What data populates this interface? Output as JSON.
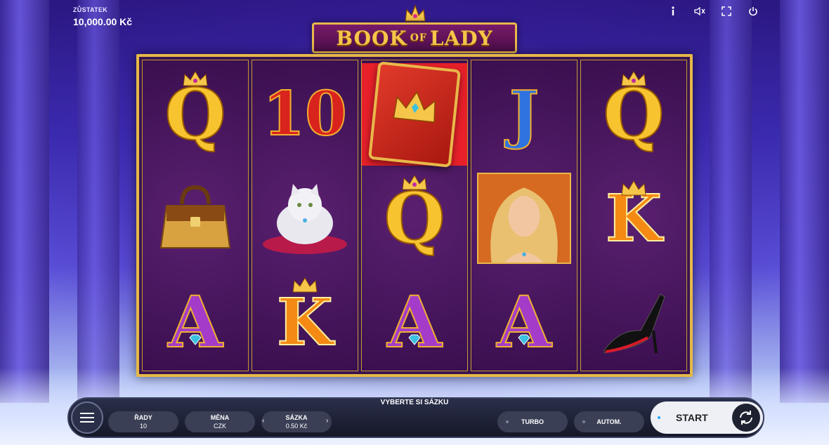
{
  "header": {
    "balance_label": "ZŮSTATEK",
    "balance_value": "10,000.00 Kč",
    "icons": [
      "info-icon",
      "volume-icon",
      "fullscreen-icon",
      "power-icon"
    ]
  },
  "logo": {
    "word1": "BOOK",
    "word2": "OF",
    "word3": "LADY"
  },
  "reels": [
    [
      "Q",
      "handbag",
      "A"
    ],
    [
      "10",
      "cat",
      "K"
    ],
    [
      "book",
      "Q",
      "A"
    ],
    [
      "J",
      "lady",
      "A"
    ],
    [
      "Q",
      "K",
      "shoe"
    ]
  ],
  "panel": {
    "title": "VYBERTE SI SÁZKU",
    "lines_label": "ŘADY",
    "lines_value": "10",
    "currency_label": "MĚNA",
    "currency_value": "CZK",
    "bet_label": "SÁZKA",
    "bet_value": "0.50 Kč",
    "turbo_label": "TURBO",
    "auto_label": "AUTOM.",
    "start_label": "START"
  },
  "colors": {
    "frame_gold": "#e6b947",
    "reel_bg": "#3a0f4f",
    "start_bg": "#eef0f5"
  }
}
